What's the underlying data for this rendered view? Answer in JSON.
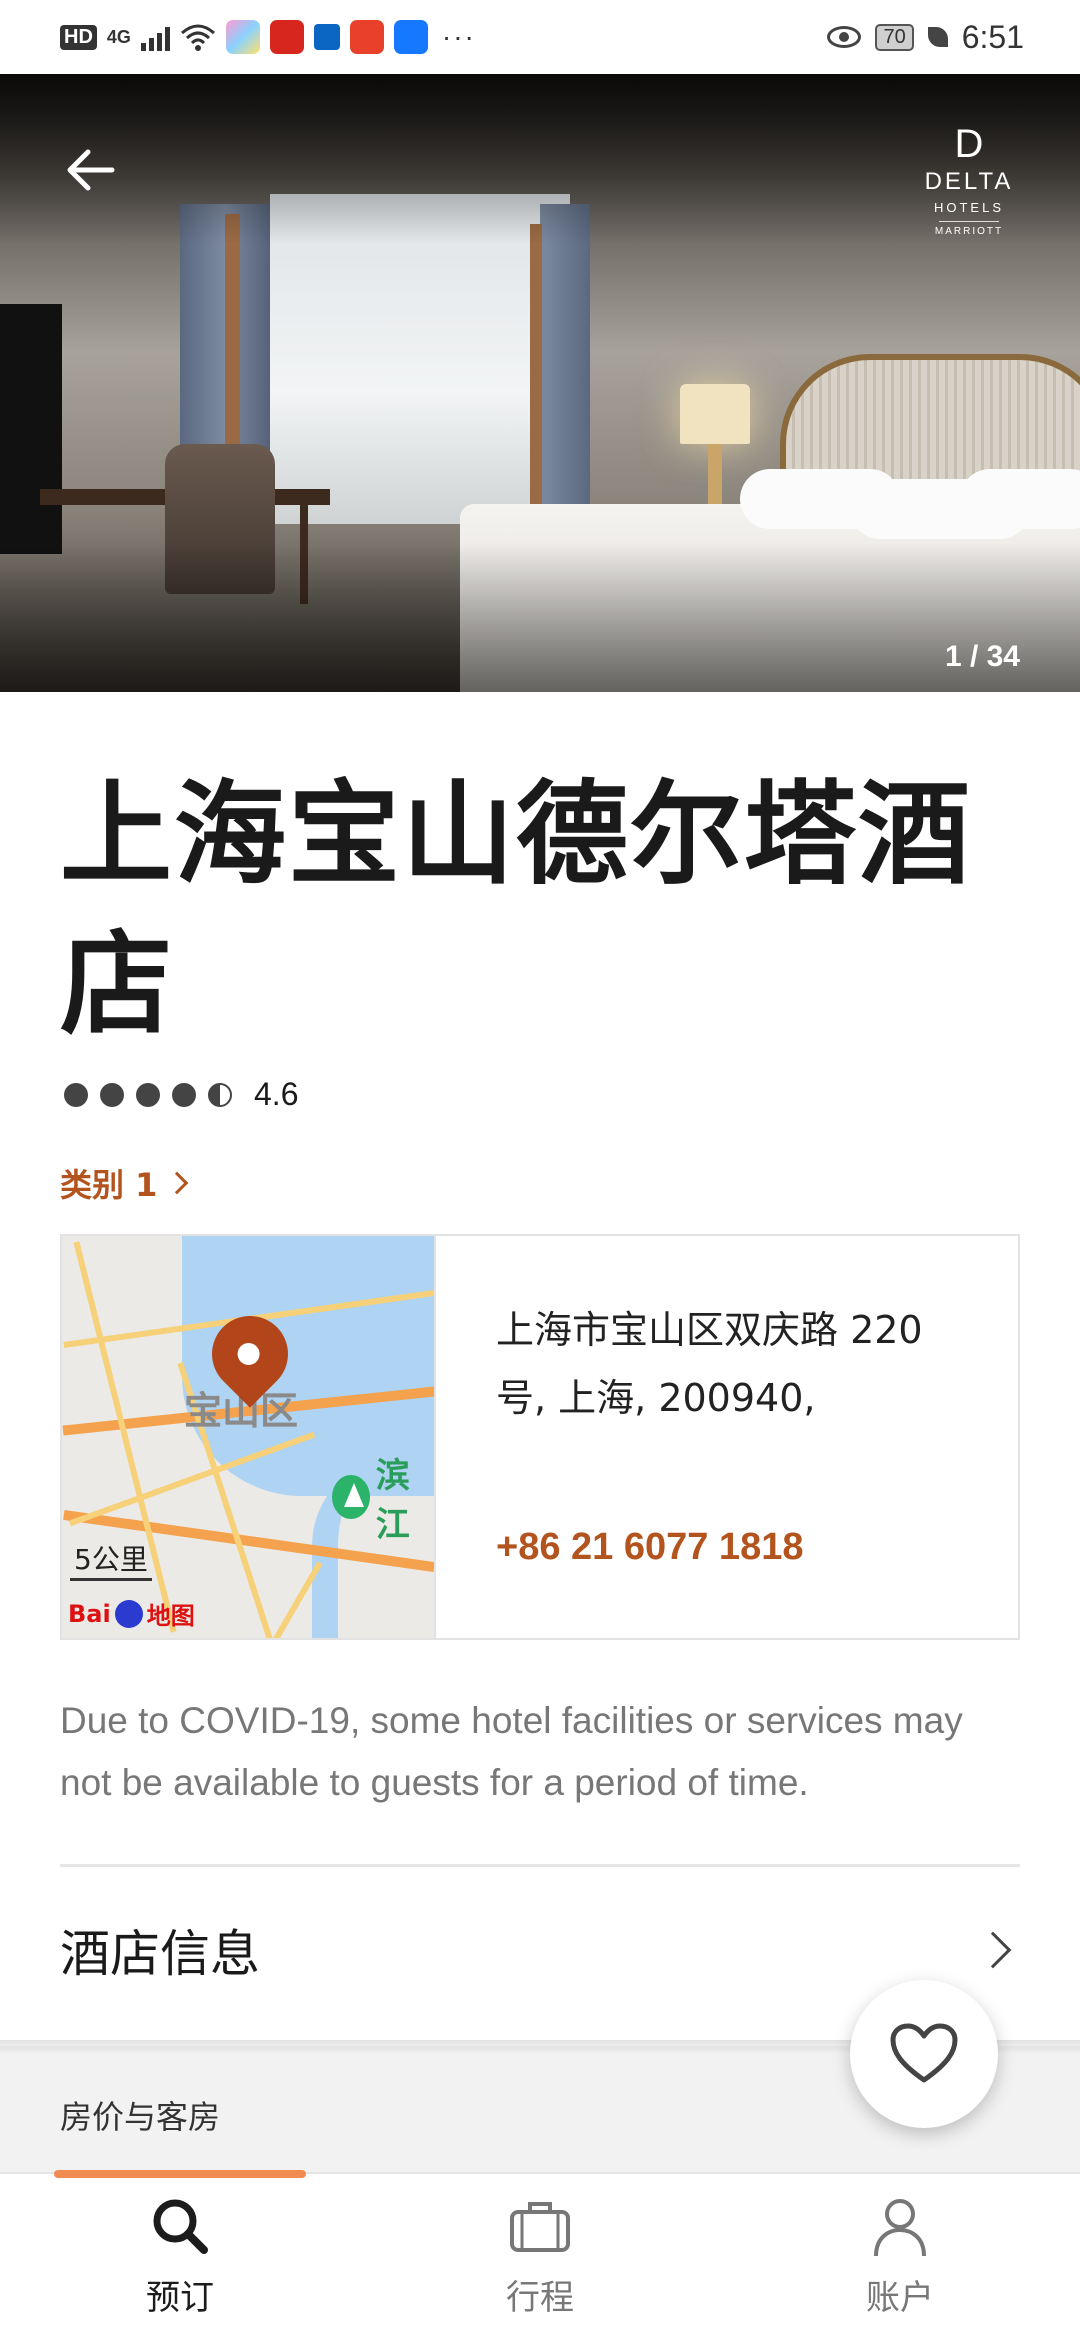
{
  "status_bar": {
    "hd": "HD",
    "network": "4G",
    "battery": "70",
    "time": "6:51",
    "overflow": "···"
  },
  "hero": {
    "brand_name": "DELTA",
    "brand_sub": "HOTELS",
    "brand_marriott": "MARRIOTT",
    "photo_counter": "1 / 34"
  },
  "hotel": {
    "name": "上海宝山德尔塔酒店",
    "rating": "4.6",
    "rating_dots_full": 4,
    "rating_dots_half": 1,
    "category": "类别 1"
  },
  "location": {
    "map_district": "宝山区",
    "map_park": "滨江",
    "map_scale": "5公里",
    "map_provider": "地图",
    "map_provider_prefix": "Bai",
    "address": "上海市宝山区双庆路 220 号, 上海, 200940,",
    "phone": "+86 21 6077 1818"
  },
  "notice": {
    "covid": "Due to COVID-19, some hotel facilities or services may not be available to guests for a period of time."
  },
  "sections": {
    "hotel_info": "酒店信息",
    "rates_rooms": "房价与客房"
  },
  "bottom_nav": {
    "items": [
      {
        "label": "预订",
        "icon": "search-icon",
        "active": true
      },
      {
        "label": "行程",
        "icon": "suitcase-icon",
        "active": false
      },
      {
        "label": "账户",
        "icon": "user-icon",
        "active": false
      }
    ]
  },
  "colors": {
    "accent": "#b3541e",
    "nav_indicator": "#f28b4f",
    "muted_text": "#777777"
  }
}
